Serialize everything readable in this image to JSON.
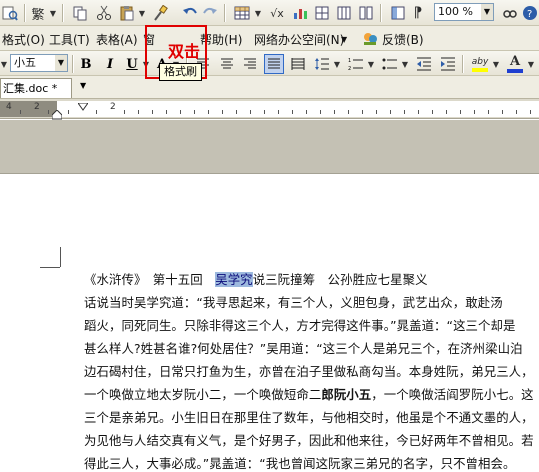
{
  "toolbar1": {
    "traditional_chinese": "繁",
    "zoom": "100 %"
  },
  "menubar": {
    "items": [
      "格式(O)",
      "工具(T)",
      "表格(A)",
      "窗",
      "帮助(H)",
      "网络办公空间(N)",
      "反馈(B)"
    ]
  },
  "toolbar2": {
    "font_size": "小五",
    "bold": "B",
    "italic": "I",
    "underline": "U",
    "font_color": "A",
    "highlight_label": "aby",
    "text_color": "A"
  },
  "doc_tab": {
    "name": "汇集.doc *"
  },
  "ruler": {
    "numbers": [
      "4",
      "2",
      "2"
    ]
  },
  "annotation": {
    "double_click": "双击",
    "tooltip": "格式刷",
    "highlight_color": "#e00000"
  },
  "document": {
    "line1": {
      "before": "《水浒传》　第十五回　",
      "selected": "吴学究",
      "after": "说三阮撞筹　公孙胜应七星聚义"
    },
    "lines": [
      "话说当时吴学究道：“我寻思起来，有三个人，义胆包身，武艺出众，敢赴汤",
      "蹈火，同死同生。只除非得这三个人，方才完得这件事。”晁盖道：“这三个却是",
      "甚么样人?姓甚名谁?何处居住？”吴用道：“这三个人是弟兄三个，在济州梁山泊",
      "边石碣村住，日常只打鱼为生，亦曾在泊子里做私商勾当。本身姓阮，弟兄三人，"
    ],
    "line6": {
      "before": "一个唤做立地太岁阮小二，一个唤做短命二",
      "bold": "郎阮小五",
      "after": "，一个唤做活阎罗阮小七。这"
    },
    "lines_after": [
      "三个是亲弟兄。小生旧日在那里住了数年，与他相交时，他虽是个不通文墨的人，",
      "为见他与人结交真有义气，是个好男子，因此和他来往，今已好两年不曾相见。若",
      "得此三人，大事必成。”晁盖道：“我也曾闻这阮家三弟兄的名字，只不曾相会。"
    ]
  }
}
